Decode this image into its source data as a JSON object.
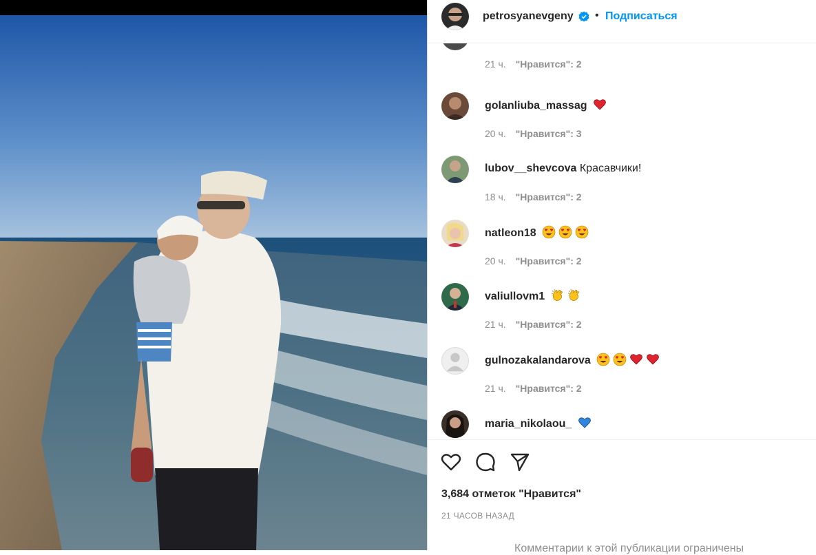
{
  "post": {
    "author": "petrosyanevgeny",
    "verified": true,
    "separator": "•",
    "follow_label": "Подписаться"
  },
  "comments": [
    {
      "user": "",
      "text": "",
      "emojis": [],
      "time": "21 ч.",
      "likes": "\"Нравится\": 2",
      "avatar_color": "#4a4a4a"
    },
    {
      "user": "golanliuba_massag",
      "text": "",
      "emojis": [
        "red-heart"
      ],
      "time": "20 ч.",
      "likes": "\"Нравится\": 3",
      "avatar_color": "#6b4a3a"
    },
    {
      "user": "lubov__shevcova",
      "text": "Красавчики!",
      "emojis": [],
      "time": "18 ч.",
      "likes": "\"Нравится\": 2",
      "avatar_color": "#5e7a5a"
    },
    {
      "user": "natleon18",
      "text": "",
      "emojis": [
        "heart-eyes",
        "heart-eyes",
        "heart-eyes"
      ],
      "time": "20 ч.",
      "likes": "\"Нравится\": 2",
      "avatar_color": "#c9a06a"
    },
    {
      "user": "valiullovm1",
      "text": "",
      "emojis": [
        "clapping-hands",
        "clapping-hands"
      ],
      "time": "21 ч.",
      "likes": "\"Нравится\": 2",
      "avatar_color": "#2f6b4a"
    },
    {
      "user": "gulnozakalandarova",
      "text": "",
      "emojis": [
        "heart-eyes",
        "heart-eyes",
        "red-heart",
        "red-heart"
      ],
      "time": "21 ч.",
      "likes": "\"Нравится\": 2",
      "avatar_color": "#dbdbdb"
    },
    {
      "user": "maria_nikolaou_",
      "text": "",
      "emojis": [
        "blue-heart"
      ],
      "time": "",
      "likes": "",
      "avatar_color": "#3a2e28"
    }
  ],
  "actions": {
    "like_icon": "heart-outline-icon",
    "comment_icon": "comment-bubble-icon",
    "share_icon": "paper-plane-icon"
  },
  "likes_total": "3,684 отметок \"Нравится\"",
  "time_ago": "21 ЧАСОВ НАЗАД",
  "comments_restricted": "Комментарии к этой публикации ограничены",
  "colors": {
    "accent": "#0095f6",
    "text": "#262626",
    "secondary": "#8e8e8e",
    "border": "#dbdbdb"
  }
}
